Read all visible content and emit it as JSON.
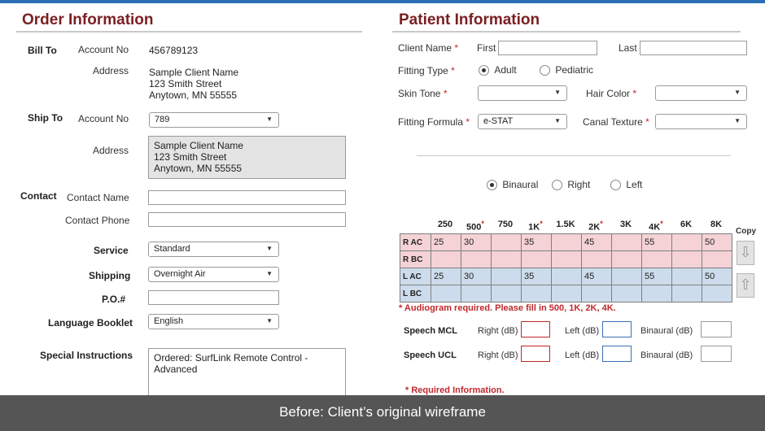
{
  "order": {
    "title": "Order Information",
    "bill_to": "Bill To",
    "bill_account_label": "Account No",
    "bill_account_value": "456789123",
    "address_label": "Address",
    "bill_address": [
      "Sample Client Name",
      "123 Smith Street",
      "Anytown, MN 55555"
    ],
    "ship_to": "Ship To",
    "ship_account_label": "Account No",
    "ship_account_value": "789",
    "ship_address_label": "Address",
    "ship_address": [
      "Sample Client Name",
      "123 Smith Street",
      "Anytown, MN 55555"
    ],
    "contact": "Contact",
    "contact_name_label": "Contact Name",
    "contact_phone_label": "Contact Phone",
    "service_label": "Service",
    "service_value": "Standard",
    "shipping_label": "Shipping",
    "shipping_value": "Overnight Air",
    "po_label": "P.O.#",
    "language_label": "Language Booklet",
    "language_value": "English",
    "instructions_label": "Special Instructions",
    "instructions_value": "Ordered: SurfLink Remote Control - Advanced"
  },
  "patient": {
    "title": "Patient Information",
    "client_name_label": "Client Name",
    "first_label": "First",
    "last_label": "Last",
    "fitting_type_label": "Fitting Type",
    "adult_label": "Adult",
    "pediatric_label": "Pediatric",
    "skin_tone_label": "Skin Tone",
    "hair_color_label": "Hair Color",
    "fitting_formula_label": "Fitting Formula",
    "fitting_formula_value": "e-STAT",
    "canal_texture_label": "Canal Texture",
    "req_mark": "*",
    "ear_options": [
      "Binaural",
      "Right",
      "Left"
    ],
    "frequencies": [
      "250",
      "500",
      "750",
      "1K",
      "1.5K",
      "2K",
      "3K",
      "4K",
      "6K",
      "8K"
    ],
    "freq_required_mark": "*",
    "rows": [
      {
        "label": "R AC",
        "values": [
          "25",
          "30",
          "",
          "35",
          "",
          "45",
          "",
          "55",
          "",
          "50"
        ]
      },
      {
        "label": "R BC",
        "values": [
          "",
          "",
          "",
          "",
          "",
          "",
          "",
          "",
          "",
          ""
        ]
      },
      {
        "label": "L AC",
        "values": [
          "25",
          "30",
          "",
          "35",
          "",
          "45",
          "",
          "55",
          "",
          "50"
        ]
      },
      {
        "label": "L BC",
        "values": [
          "",
          "",
          "",
          "",
          "",
          "",
          "",
          "",
          "",
          ""
        ]
      }
    ],
    "copy_label": "Copy",
    "audiogram_note": "* Audiogram required. Please fill in 500, 1K, 2K, 4K.",
    "speech_mcl": "Speech MCL",
    "speech_ucl": "Speech UCL",
    "right_db": "Right (dB)",
    "left_db": "Left (dB)",
    "binaural_db": "Binaural (dB)",
    "required_note": "* Required Information."
  },
  "caption": "Before: Client’s original wireframe",
  "colors": {
    "title": "#7a1f22",
    "required": "#c0282b",
    "right_row": "#f4d2d6",
    "left_row": "#cddcec",
    "caption_bar": "#555555"
  }
}
